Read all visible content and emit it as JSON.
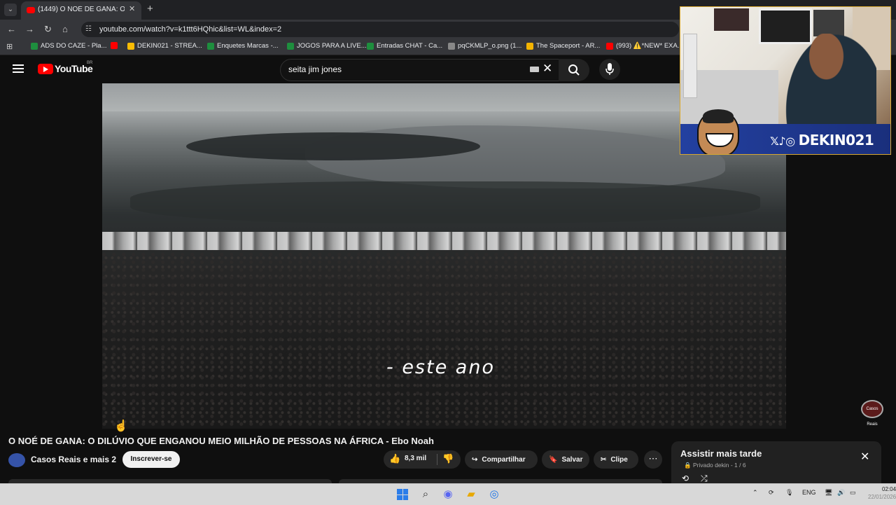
{
  "browser": {
    "tab_title": "(1449) O NOÉ DE GANA: O DILÚ",
    "url": "youtube.com/watch?v=k1ttt6HQhic&list=WL&index=2",
    "bookmarks": [
      {
        "label": "ADS DO CAZE - Pla...",
        "color": "#1e8e3e"
      },
      {
        "label": "DEKIN021 - STREA...",
        "color": "#fbbc04"
      },
      {
        "label": "Enquetes Marcas -...",
        "color": "#1e8e3e"
      },
      {
        "label": "JOGOS PARA A LIVE...",
        "color": "#1e8e3e"
      },
      {
        "label": "Entradas CHAT - Ca...",
        "color": "#1e8e3e"
      },
      {
        "label": "pqCKMLP_o.png (1...",
        "color": "#888888"
      },
      {
        "label": "The Spaceport - AR...",
        "color": "#f4b400"
      },
      {
        "label": "(993) ⚠️*NEW* EXA...",
        "color": "#ff0000"
      }
    ]
  },
  "youtube": {
    "logo_text": "YouTube",
    "region": "BR",
    "search_value": "seita jim jones",
    "video": {
      "subtitle": "- este ano",
      "watermark": "Casos Reais"
    },
    "title": "O NOÉ DE GANA: O DILÚVIO QUE ENGANOU MEIO MILHÃO DE PESSOAS NA ÁFRICA - Ebo Noah",
    "channel": "Casos Reais e mais 2",
    "subscribe_label": "Inscrever-se",
    "likes": "8,3 mil",
    "share_label": "Compartilhar",
    "save_label": "Salvar",
    "clip_label": "Clipe",
    "playlist": {
      "title": "Assistir mais tarde",
      "subtitle": "Privado dekin - 1 / 6"
    }
  },
  "overlay": {
    "handle": "DEKIN021"
  },
  "taskbar": {
    "lang": "ENG",
    "time": "02:04",
    "date": "22/01/2026"
  }
}
